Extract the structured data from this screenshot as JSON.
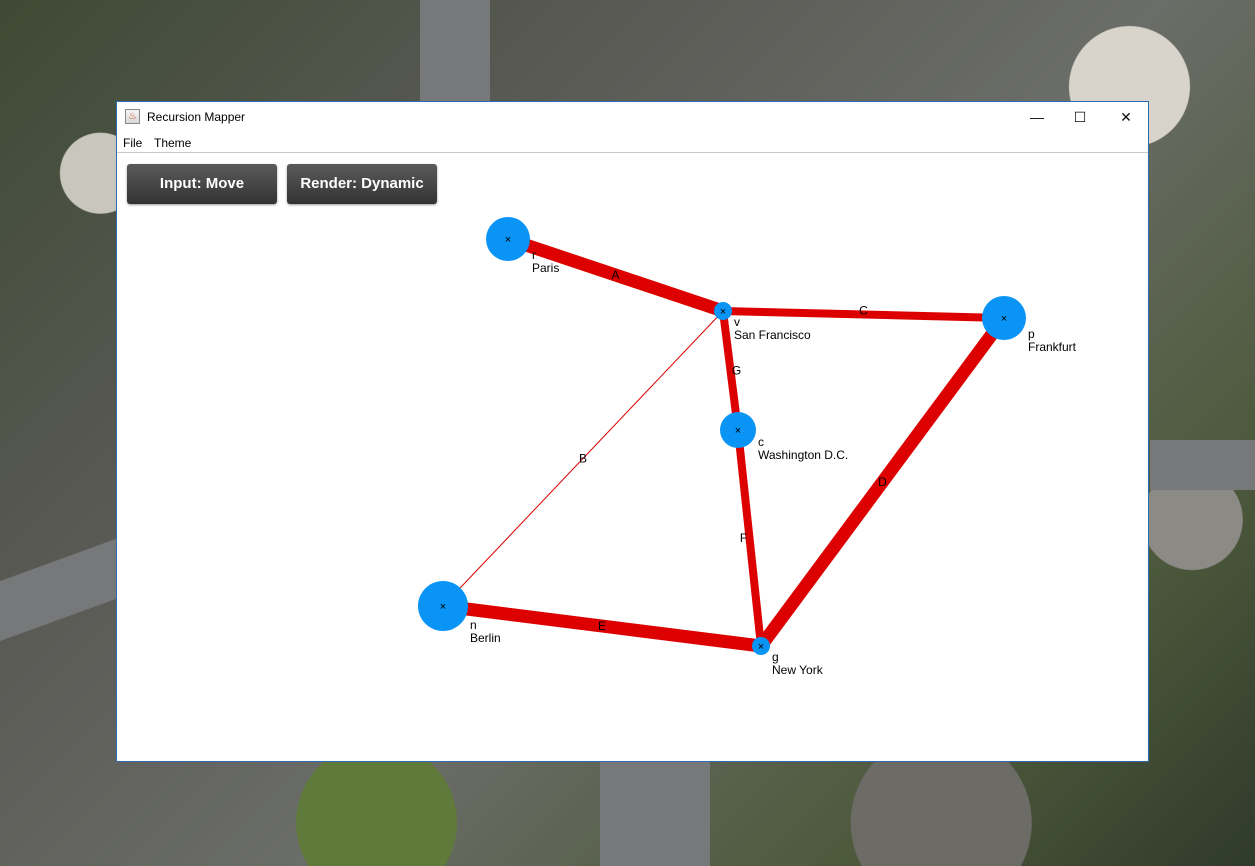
{
  "window": {
    "title": "Recursion Mapper"
  },
  "menu": {
    "file": "File",
    "theme": "Theme"
  },
  "toolbar": {
    "input_label": "Input: Move",
    "render_label": "Render: Dynamic"
  },
  "colors": {
    "node": "#0a94f5",
    "edge": "#dd0000"
  },
  "graph": {
    "nodes": [
      {
        "id": "r",
        "name": "Paris",
        "size": "large"
      },
      {
        "id": "v",
        "name": "San Francisco",
        "size": "small"
      },
      {
        "id": "p",
        "name": "Frankfurt",
        "size": "large"
      },
      {
        "id": "c",
        "name": "Washington D.C.",
        "size": "medium"
      },
      {
        "id": "n",
        "name": "Berlin",
        "size": "xlarge"
      },
      {
        "id": "g",
        "name": "New York",
        "size": "small"
      }
    ],
    "edges": [
      {
        "label": "A",
        "from": "r",
        "to": "v",
        "weight": "heavy"
      },
      {
        "label": "C",
        "from": "v",
        "to": "p",
        "weight": "medium"
      },
      {
        "label": "G",
        "from": "v",
        "to": "c",
        "weight": "medium"
      },
      {
        "label": "B",
        "from": "v",
        "to": "n",
        "weight": "thin"
      },
      {
        "label": "F",
        "from": "c",
        "to": "g",
        "weight": "medium"
      },
      {
        "label": "D",
        "from": "p",
        "to": "g",
        "weight": "heavy"
      },
      {
        "label": "E",
        "from": "n",
        "to": "g",
        "weight": "heavy"
      }
    ]
  }
}
